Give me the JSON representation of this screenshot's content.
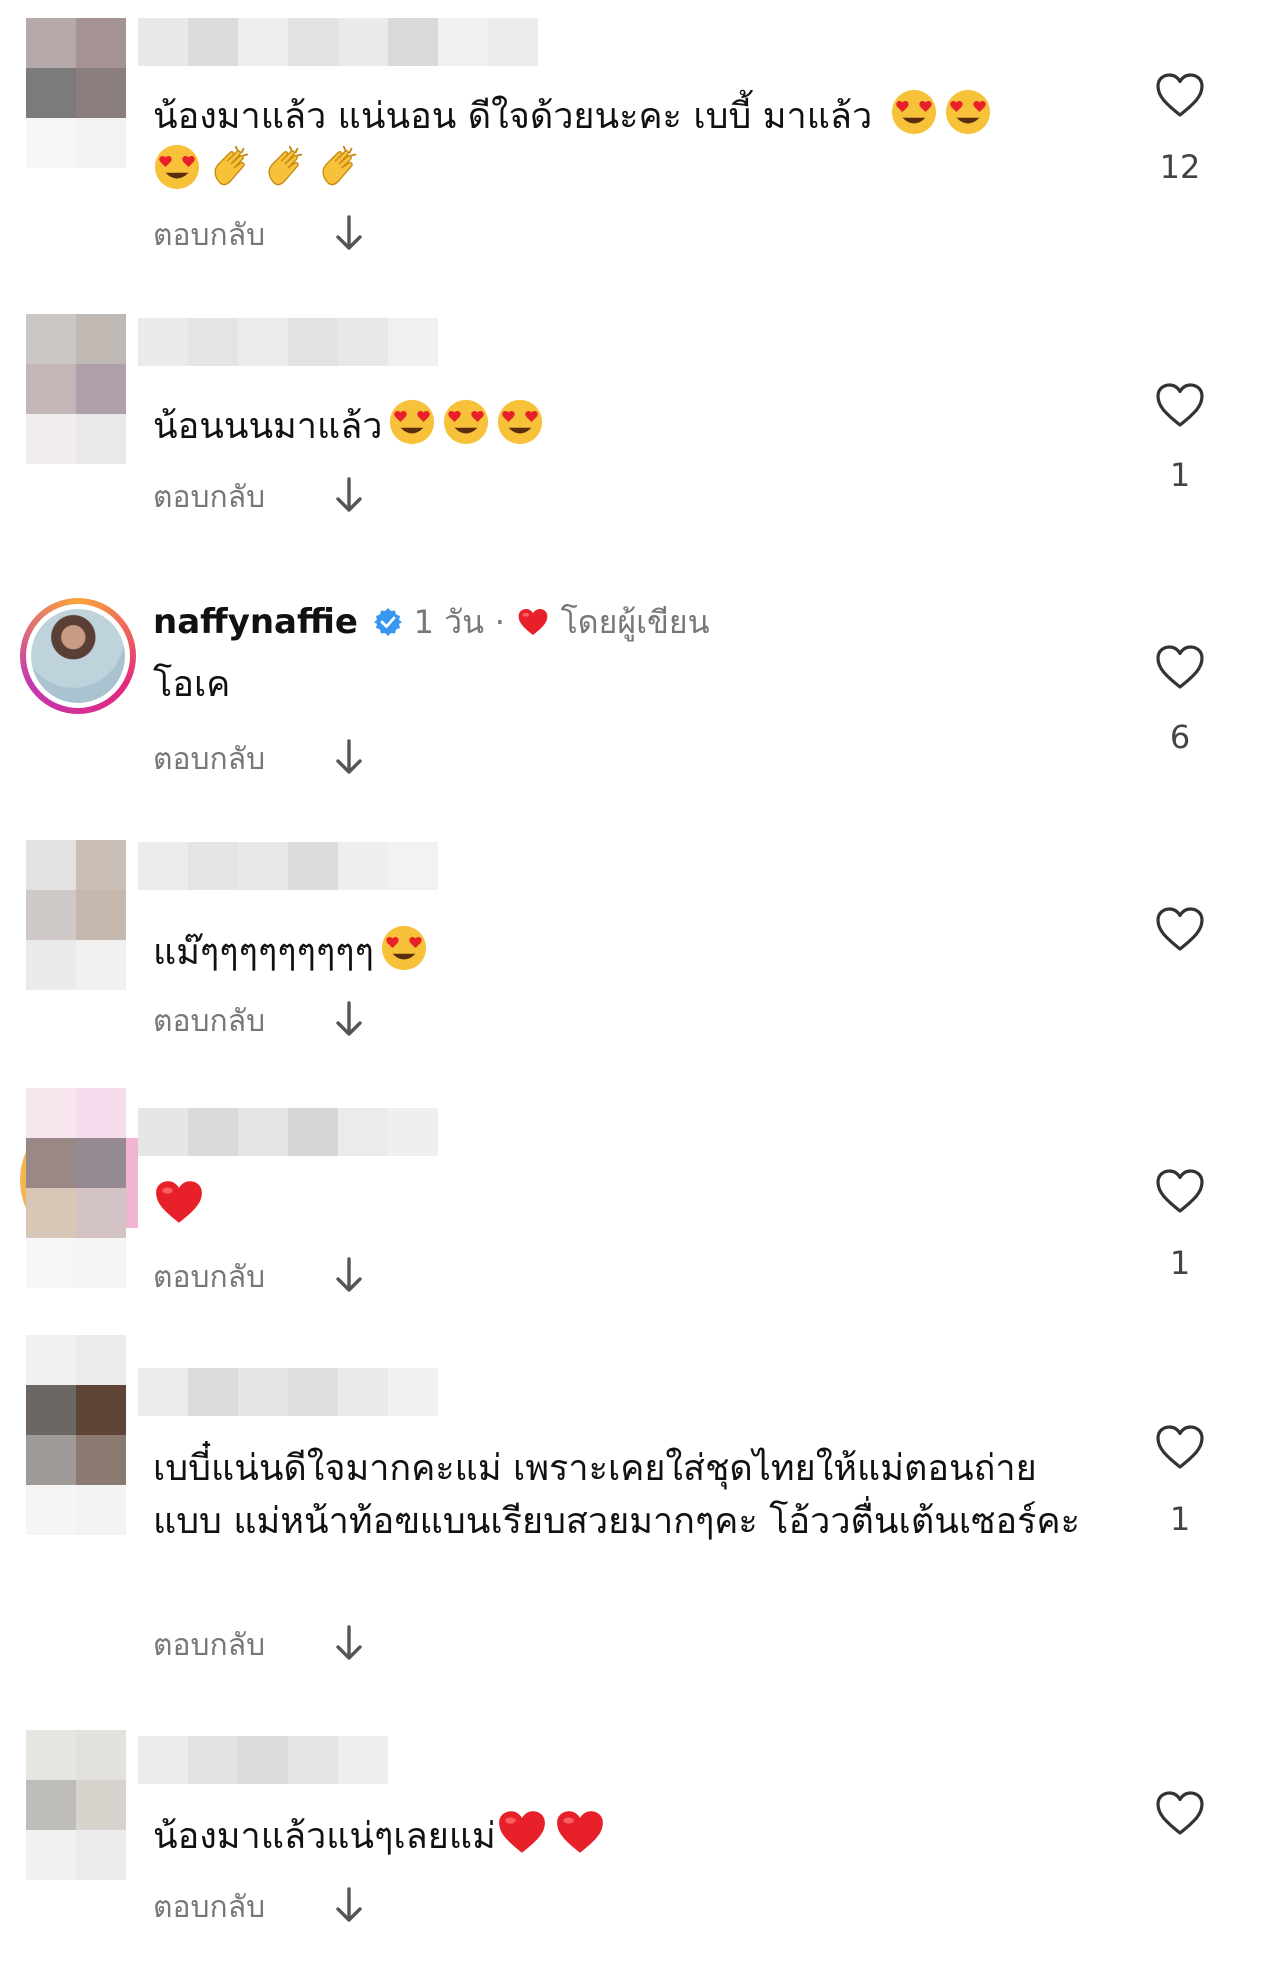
{
  "reply_label": "ตอบกลับ",
  "comments": [
    {
      "text": "น้องมาแล้ว แน่นอน ดีใจด้วยนะคะ เบบี้ มาแล้ว",
      "likes": "12"
    },
    {
      "text": "น้อนนนมาแล้ว",
      "likes": "1"
    },
    {
      "username": "naffynaffie",
      "verified": true,
      "time": "1 วัน",
      "author_like_label": "โดยผู้เขียน",
      "text": "โอเค",
      "likes": "6"
    },
    {
      "text": "แม๊ๆๆๆๆๆๆๆๆๆ",
      "likes": ""
    },
    {
      "text": "",
      "likes": "1"
    },
    {
      "text": "เบบี๋แน่นดีใจมากคะแม่ เพราะเคยใส่ชุดไทยให้แม่ตอนถ่ายแบบ แม่หน้าท้อฃแบนเรียบสวยมากๆคะ โอ้ววตื่นเต้นเซอร์คะ",
      "likes": "1"
    },
    {
      "text": "น้องมาแล้วแน่ๆเลยแม่",
      "likes": ""
    }
  ],
  "colors": {
    "heart_red": "#e8202a",
    "verified_blue": "#3897f0",
    "muted": "#777777"
  }
}
